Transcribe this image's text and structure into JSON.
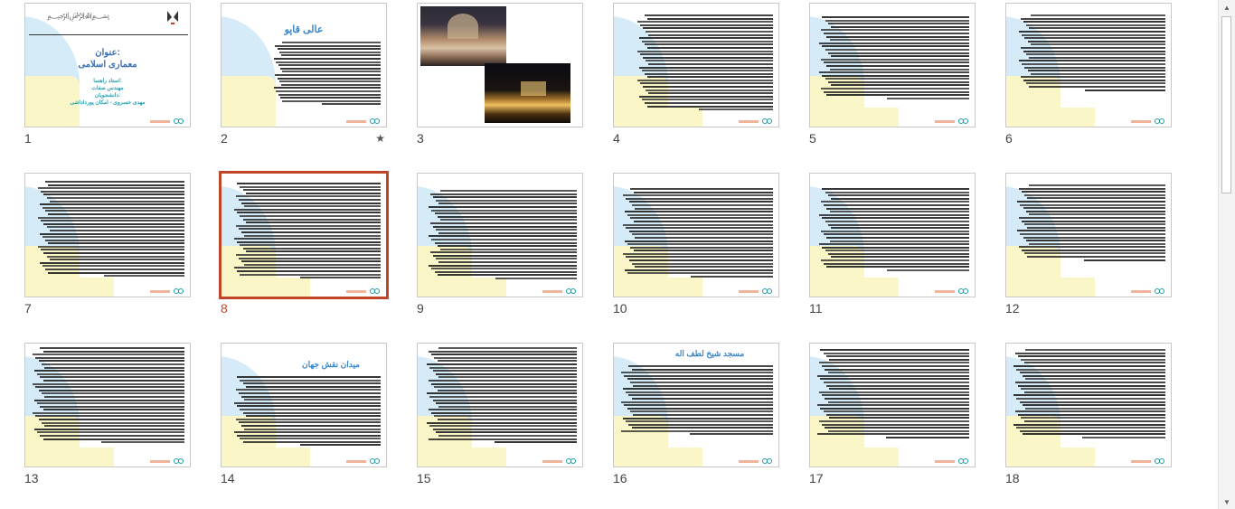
{
  "slides": [
    {
      "number": "1",
      "type": "title",
      "title_line1": "عنوان:",
      "title_line2": "معماری اسلامی",
      "sub1": "استاد راهنما:",
      "sub2": "مهندس صفات",
      "sub3": "دانشجویان:",
      "sub4": "مهدی خسروی - امکان پورداداشی"
    },
    {
      "number": "2",
      "type": "titled",
      "title": "عالی قاپو",
      "starred": true,
      "star": "★"
    },
    {
      "number": "3",
      "type": "photos"
    },
    {
      "number": "4",
      "type": "text"
    },
    {
      "number": "5",
      "type": "text"
    },
    {
      "number": "6",
      "type": "text"
    },
    {
      "number": "7",
      "type": "text"
    },
    {
      "number": "8",
      "type": "text",
      "selected": true
    },
    {
      "number": "9",
      "type": "text"
    },
    {
      "number": "10",
      "type": "text"
    },
    {
      "number": "11",
      "type": "text"
    },
    {
      "number": "12",
      "type": "text"
    },
    {
      "number": "13",
      "type": "text"
    },
    {
      "number": "14",
      "type": "titled",
      "title": "میدان نقش جهان"
    },
    {
      "number": "15",
      "type": "text"
    },
    {
      "number": "16",
      "type": "titled",
      "title": "مسجد شیخ لطف اله"
    },
    {
      "number": "17",
      "type": "text"
    },
    {
      "number": "18",
      "type": "text"
    }
  ],
  "colors": {
    "selection": "#c0462a",
    "title_blue": "#3b86c9",
    "template_blue": "#d5ebf8",
    "template_yellow": "#fbf6c8",
    "teal": "#1aa0a8"
  },
  "scrollbar": {
    "up_icon": "triangle-up",
    "down_icon": "triangle-down"
  }
}
